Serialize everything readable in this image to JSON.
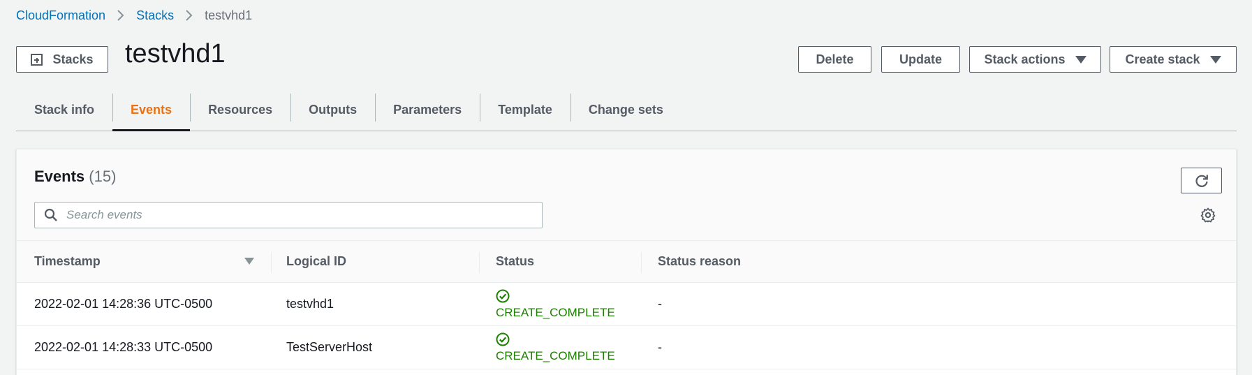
{
  "breadcrumb": {
    "items": [
      "CloudFormation",
      "Stacks",
      "testvhd1"
    ]
  },
  "header": {
    "stacks_button": "Stacks",
    "title": "testvhd1",
    "delete_label": "Delete",
    "update_label": "Update",
    "stack_actions_label": "Stack actions",
    "create_stack_label": "Create stack"
  },
  "tabs": [
    {
      "label": "Stack info"
    },
    {
      "label": "Events"
    },
    {
      "label": "Resources"
    },
    {
      "label": "Outputs"
    },
    {
      "label": "Parameters"
    },
    {
      "label": "Template"
    },
    {
      "label": "Change sets"
    }
  ],
  "active_tab": "Events",
  "events": {
    "title": "Events",
    "count": "(15)",
    "search_placeholder": "Search events",
    "columns": [
      "Timestamp",
      "Logical ID",
      "Status",
      "Status reason"
    ],
    "rows": [
      {
        "timestamp": "2022-02-01 14:28:36 UTC-0500",
        "logical_id": "testvhd1",
        "status": "CREATE_COMPLETE",
        "reason": "-"
      },
      {
        "timestamp": "2022-02-01 14:28:33 UTC-0500",
        "logical_id": "TestServerHost",
        "status": "CREATE_COMPLETE",
        "reason": "-"
      }
    ]
  },
  "colors": {
    "link": "#0073bb",
    "active_tab": "#ec7211",
    "success": "#1d8102"
  },
  "icons": [
    "plus-box-icon",
    "caret-down-icon",
    "refresh-icon",
    "search-icon",
    "settings-gear-icon",
    "sort-caret-icon",
    "status-check-icon"
  ]
}
